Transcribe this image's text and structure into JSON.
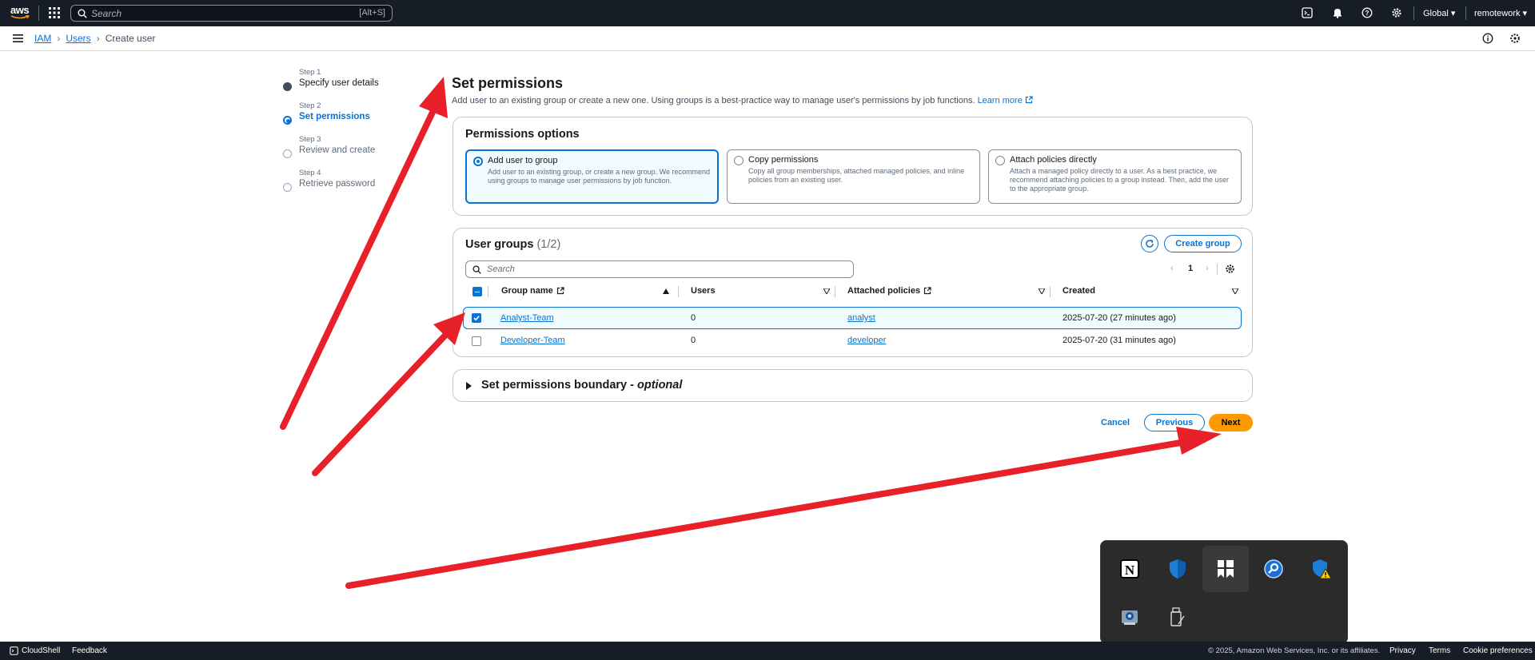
{
  "topnav": {
    "logo_text": "aws",
    "search_placeholder": "Search",
    "search_shortcut": "[Alt+S]",
    "region": "Global",
    "account": "remotework"
  },
  "breadcrumb": {
    "items": [
      "IAM",
      "Users",
      "Create user"
    ]
  },
  "steps": [
    {
      "num": "Step 1",
      "label": "Specify user details",
      "state": "done"
    },
    {
      "num": "Step 2",
      "label": "Set permissions",
      "state": "active"
    },
    {
      "num": "Step 3",
      "label": "Review and create",
      "state": "todo"
    },
    {
      "num": "Step 4",
      "label": "Retrieve password",
      "state": "todo"
    }
  ],
  "page": {
    "title": "Set permissions",
    "description": "Add user to an existing group or create a new one. Using groups is a best-practice way to manage user's permissions by job functions.",
    "learn_more": "Learn more"
  },
  "permissions_options": {
    "title": "Permissions options",
    "tiles": [
      {
        "title": "Add user to group",
        "desc": "Add user to an existing group, or create a new group. We recommend using groups to manage user permissions by job function.",
        "selected": true
      },
      {
        "title": "Copy permissions",
        "desc": "Copy all group memberships, attached managed policies, and inline policies from an existing user.",
        "selected": false
      },
      {
        "title": "Attach policies directly",
        "desc": "Attach a managed policy directly to a user. As a best practice, we recommend attaching policies to a group instead. Then, add the user to the appropriate group.",
        "selected": false
      }
    ]
  },
  "user_groups": {
    "title": "User groups",
    "count": "(1/2)",
    "create_group": "Create group",
    "search_placeholder": "Search",
    "page": "1",
    "columns": [
      "Group name",
      "Users",
      "Attached policies",
      "Created"
    ],
    "rows": [
      {
        "name": "Analyst-Team",
        "users": "0",
        "policy": "analyst",
        "created": "2025-07-20 (27 minutes ago)",
        "selected": true
      },
      {
        "name": "Developer-Team",
        "users": "0",
        "policy": "developer",
        "created": "2025-07-20 (31 minutes ago)",
        "selected": false
      }
    ]
  },
  "boundary": {
    "title": "Set permissions boundary - ",
    "optional": "optional"
  },
  "actions": {
    "cancel": "Cancel",
    "previous": "Previous",
    "next": "Next"
  },
  "footer": {
    "cloudshell": "CloudShell",
    "feedback": "Feedback",
    "copyright": "© 2025, Amazon Web Services, Inc. or its affiliates.",
    "privacy": "Privacy",
    "terms": "Terms",
    "cookies": "Cookie preferences"
  },
  "tray": {
    "icons": [
      "notion-icon",
      "defender-shield-icon",
      "bookmark-app-icon",
      "magnifier-tool-icon",
      "security-warning-shield-icon",
      "webcam-app-icon",
      "usb-drive-icon"
    ]
  },
  "colors": {
    "nav_bg": "#161d26",
    "accent": "#0972d3",
    "primary_button": "#ff9900",
    "annotation_arrow": "#e8202a"
  }
}
